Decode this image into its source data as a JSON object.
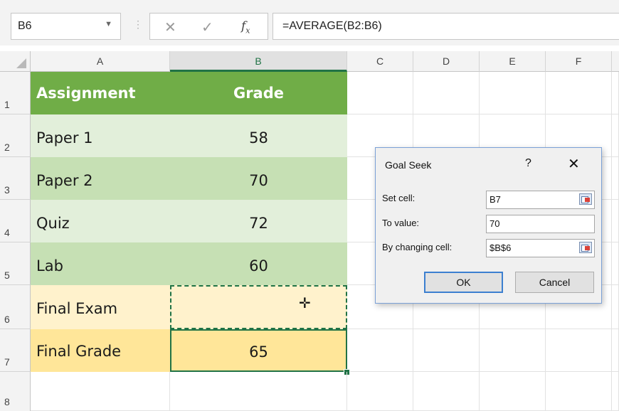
{
  "formula_bar": {
    "name_box": "B6",
    "cancel_icon": "close-icon",
    "enter_icon": "check-icon",
    "fx_label": "fx",
    "formula": "=AVERAGE(B2:B6)"
  },
  "columns": [
    "A",
    "B",
    "C",
    "D",
    "E",
    "F"
  ],
  "selected_column": "B",
  "rows": [
    "1",
    "2",
    "3",
    "4",
    "5",
    "6",
    "7",
    "8"
  ],
  "table": {
    "header": {
      "assignment": "Assignment",
      "grade": "Grade"
    },
    "rows": [
      {
        "assignment": "Paper 1",
        "grade": "58"
      },
      {
        "assignment": "Paper 2",
        "grade": "70"
      },
      {
        "assignment": "Quiz",
        "grade": "72"
      },
      {
        "assignment": "Lab",
        "grade": "60"
      },
      {
        "assignment": "Final Exam",
        "grade": ""
      },
      {
        "assignment": "Final Grade",
        "grade": "65"
      }
    ]
  },
  "colors": {
    "header_green": "#70ad47",
    "light_green": "#e2efda",
    "mid_green": "#c6e0b4",
    "light_orange": "#fff2cc",
    "orange": "#ffe699",
    "selection": "#217346"
  },
  "goal_seek": {
    "title": "Goal Seek",
    "help": "?",
    "close": "✕",
    "set_cell_label": "Set cell:",
    "set_cell_value": "B7",
    "to_value_label": "To value:",
    "to_value_value": "70",
    "changing_label": "By changing cell:",
    "changing_value": "$B$6",
    "ok": "OK",
    "cancel": "Cancel"
  }
}
